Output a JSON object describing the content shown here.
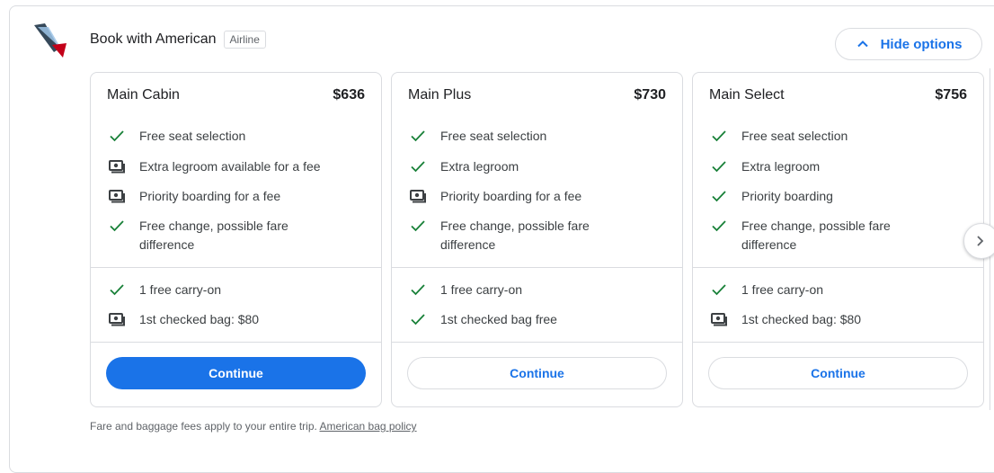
{
  "header": {
    "airline_logo": "american-airlines-logo",
    "title": "Book with American",
    "badge": "Airline",
    "hide_options_label": "Hide options",
    "hide_options_icon": "chevron-up-icon"
  },
  "cards": [
    {
      "name": "Main Cabin",
      "price": "$636",
      "features": [
        {
          "icon": "check-icon",
          "text": "Free seat selection"
        },
        {
          "icon": "money-icon",
          "text": "Extra legroom available for a fee"
        },
        {
          "icon": "money-icon",
          "text": "Priority boarding for a fee"
        },
        {
          "icon": "check-icon",
          "text": "Free change, possible fare difference"
        }
      ],
      "bags": [
        {
          "icon": "check-icon",
          "text": "1 free carry-on"
        },
        {
          "icon": "money-icon",
          "text": "1st checked bag: $80"
        }
      ],
      "button": "Continue",
      "primary": true
    },
    {
      "name": "Main Plus",
      "price": "$730",
      "features": [
        {
          "icon": "check-icon",
          "text": "Free seat selection"
        },
        {
          "icon": "check-icon",
          "text": "Extra legroom"
        },
        {
          "icon": "money-icon",
          "text": "Priority boarding for a fee"
        },
        {
          "icon": "check-icon",
          "text": "Free change, possible fare difference"
        }
      ],
      "bags": [
        {
          "icon": "check-icon",
          "text": "1 free carry-on"
        },
        {
          "icon": "check-icon",
          "text": "1st checked bag free"
        }
      ],
      "button": "Continue",
      "primary": false
    },
    {
      "name": "Main Select",
      "price": "$756",
      "features": [
        {
          "icon": "check-icon",
          "text": "Free seat selection"
        },
        {
          "icon": "check-icon",
          "text": "Extra legroom"
        },
        {
          "icon": "check-icon",
          "text": "Priority boarding"
        },
        {
          "icon": "check-icon",
          "text": "Free change, possible fare difference"
        }
      ],
      "bags": [
        {
          "icon": "check-icon",
          "text": "1 free carry-on"
        },
        {
          "icon": "money-icon",
          "text": "1st checked bag: $80"
        }
      ],
      "button": "Continue",
      "primary": false
    }
  ],
  "next_icon": "chevron-right-icon",
  "footer": {
    "text": "Fare and baggage fees apply to your entire trip.",
    "link": "American bag policy"
  },
  "colors": {
    "accent": "#1a73e8",
    "check": "#188038",
    "border": "#dadce0",
    "logo_red": "#c30019",
    "logo_blue": "#36495a",
    "logo_light_blue": "#9dc4e8"
  }
}
